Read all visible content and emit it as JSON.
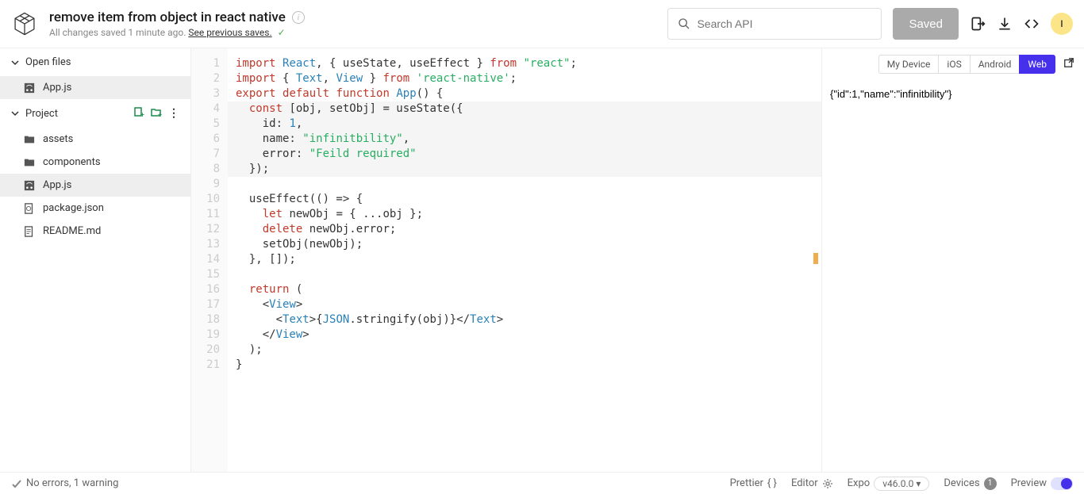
{
  "header": {
    "title": "remove item from object in react native",
    "saved_prefix": "All changes saved 1 minute ago. ",
    "saved_link": "See previous saves.",
    "search_placeholder": "Search API",
    "saved_button": "Saved",
    "avatar_initial": "I"
  },
  "sidebar": {
    "open_files_label": "Open files",
    "open_files": [
      {
        "name": "App.js",
        "type": "js"
      }
    ],
    "project_label": "Project",
    "project_items": [
      {
        "name": "assets",
        "type": "folder"
      },
      {
        "name": "components",
        "type": "folder"
      },
      {
        "name": "App.js",
        "type": "js",
        "active": true
      },
      {
        "name": "package.json",
        "type": "json"
      },
      {
        "name": "README.md",
        "type": "md"
      }
    ]
  },
  "editor": {
    "line_count": 21,
    "highlight_start": 4,
    "highlight_end": 8,
    "code_lines": [
      [
        [
          "kw",
          "import"
        ],
        [
          "punct",
          " "
        ],
        [
          "type",
          "React"
        ],
        [
          "punct",
          ", { useState, useEffect } "
        ],
        [
          "kw",
          "from"
        ],
        [
          "punct",
          " "
        ],
        [
          "str",
          "\"react\""
        ],
        [
          "punct",
          ";"
        ]
      ],
      [
        [
          "kw",
          "import"
        ],
        [
          "punct",
          " { "
        ],
        [
          "type",
          "Text"
        ],
        [
          "punct",
          ", "
        ],
        [
          "type",
          "View"
        ],
        [
          "punct",
          " } "
        ],
        [
          "kw",
          "from"
        ],
        [
          "punct",
          " "
        ],
        [
          "str",
          "'react-native'"
        ],
        [
          "punct",
          ";"
        ]
      ],
      [
        [
          "kw",
          "export"
        ],
        [
          "punct",
          " "
        ],
        [
          "kw",
          "default"
        ],
        [
          "punct",
          " "
        ],
        [
          "kw",
          "function"
        ],
        [
          "punct",
          " "
        ],
        [
          "fn",
          "App"
        ],
        [
          "punct",
          "() {"
        ]
      ],
      [
        [
          "punct",
          "  "
        ],
        [
          "kw",
          "const"
        ],
        [
          "punct",
          " [obj, setObj] = useState({"
        ]
      ],
      [
        [
          "punct",
          "    id: "
        ],
        [
          "num",
          "1"
        ],
        [
          "punct",
          ","
        ]
      ],
      [
        [
          "punct",
          "    name: "
        ],
        [
          "str",
          "\"infinitbility\""
        ],
        [
          "punct",
          ","
        ]
      ],
      [
        [
          "punct",
          "    error: "
        ],
        [
          "str",
          "\"Feild required\""
        ]
      ],
      [
        [
          "punct",
          "  });"
        ]
      ],
      [
        [
          "punct",
          ""
        ]
      ],
      [
        [
          "punct",
          "  useEffect(() => {"
        ]
      ],
      [
        [
          "punct",
          "    "
        ],
        [
          "kw",
          "let"
        ],
        [
          "punct",
          " newObj = { ...obj };"
        ]
      ],
      [
        [
          "punct",
          "    "
        ],
        [
          "kw",
          "delete"
        ],
        [
          "punct",
          " newObj.error;"
        ]
      ],
      [
        [
          "punct",
          "    setObj(newObj);"
        ]
      ],
      [
        [
          "punct",
          "  }, []);"
        ]
      ],
      [
        [
          "punct",
          ""
        ]
      ],
      [
        [
          "punct",
          "  "
        ],
        [
          "kw",
          "return"
        ],
        [
          "punct",
          " ("
        ]
      ],
      [
        [
          "punct",
          "    <"
        ],
        [
          "tag",
          "View"
        ],
        [
          "punct",
          ">"
        ]
      ],
      [
        [
          "punct",
          "      <"
        ],
        [
          "tag",
          "Text"
        ],
        [
          "punct",
          ">{"
        ],
        [
          "type",
          "JSON"
        ],
        [
          "punct",
          ".stringify(obj)}</"
        ],
        [
          "tag",
          "Text"
        ],
        [
          "punct",
          ">"
        ]
      ],
      [
        [
          "punct",
          "    </"
        ],
        [
          "tag",
          "View"
        ],
        [
          "punct",
          ">"
        ]
      ],
      [
        [
          "punct",
          "  );"
        ]
      ],
      [
        [
          "punct",
          "}"
        ]
      ]
    ]
  },
  "preview": {
    "tabs": [
      "My Device",
      "iOS",
      "Android",
      "Web"
    ],
    "active_tab": "Web",
    "output": "{\"id\":1,\"name\":\"infinitbility\"}"
  },
  "footer": {
    "status": "No errors, 1 warning",
    "prettier": "Prettier",
    "editor": "Editor",
    "expo": "Expo",
    "expo_version": "v46.0.0 ▾",
    "devices": "Devices",
    "devices_count": "1",
    "preview": "Preview"
  }
}
